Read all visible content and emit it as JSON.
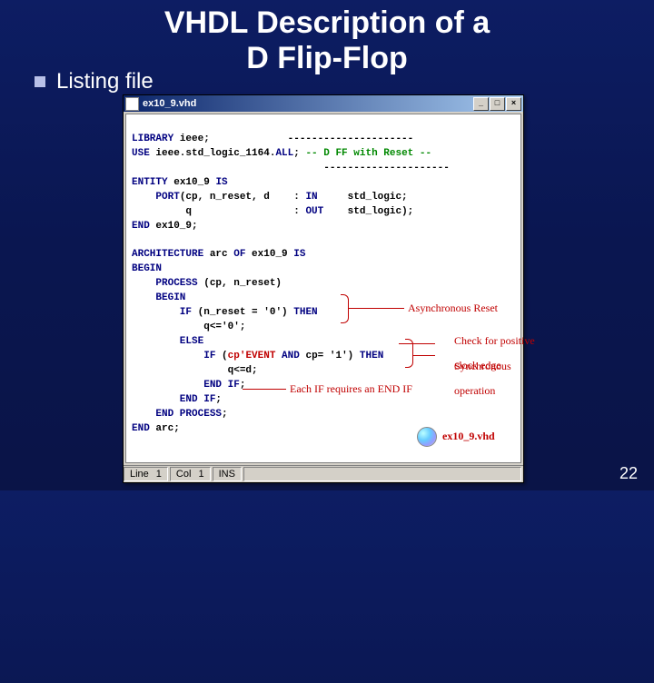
{
  "title_line1": "VHDL Description of a",
  "title_line2": "D Flip-Flop",
  "bullet_text": "Listing file",
  "window": {
    "filename": "ex10_9.vhd",
    "btn_min": "_",
    "btn_max": "□",
    "btn_close": "×"
  },
  "code": {
    "l1a": "LIBRARY ",
    "l1b": "ieee;             ---------------------",
    "l2a": "USE ",
    "l2b": "ieee.std_logic_1164.",
    "l2c": "ALL",
    "l2d": "; ",
    "l2e": "-- D FF with Reset --",
    "l3": "                                ---------------------",
    "l4a": "ENTITY ",
    "l4b": "ex10_9 ",
    "l4c": "IS",
    "l5a": "    PORT",
    "l5b": "(cp, n_reset, d    : ",
    "l5c": "IN",
    "l5d": "     std_logic;",
    "l6a": "         ",
    "l6b": "q                 : ",
    "l6c": "OUT",
    "l6d": "    std_logic);",
    "l7a": "END ",
    "l7b": "ex10_9;",
    "l8": " ",
    "l9a": "ARCHITECTURE ",
    "l9b": "arc ",
    "l9c": "OF ",
    "l9d": "ex10_9 ",
    "l9e": "IS",
    "l10": "BEGIN",
    "l11a": "    PROCESS ",
    "l11b": "(cp, n_reset)",
    "l12": "    BEGIN",
    "l13a": "        IF ",
    "l13b": "(n_reset = '0') ",
    "l13c": "THEN",
    "l14a": "            ",
    "l14b": "q<='0';",
    "l15": "        ELSE",
    "l16a": "            IF ",
    "l16b": "(",
    "l16c": "cp'EVENT",
    "l16d": " AND ",
    "l16e": "cp= '1') ",
    "l16f": "THEN",
    "l17a": "                ",
    "l17b": "q<=d;",
    "l18a": "            END IF",
    "l18b": ";",
    "l19a": "        END IF",
    "l19b": ";",
    "l20a": "    END PROCESS",
    "l20b": ";",
    "l21a": "END ",
    "l21b": "arc;"
  },
  "annotations": {
    "a1": "Asynchronous Reset",
    "a2a": "Check for positive",
    "a2b": "clock edge",
    "a3a": "Synchronous",
    "a3b": "operation",
    "a4": "Each IF requires an END IF"
  },
  "cd_label": "ex10_9.vhd",
  "status": {
    "line_lbl": "Line",
    "line_v": "1",
    "col_lbl": "Col",
    "col_v": "1",
    "ins": "INS"
  },
  "slide_number": "22"
}
